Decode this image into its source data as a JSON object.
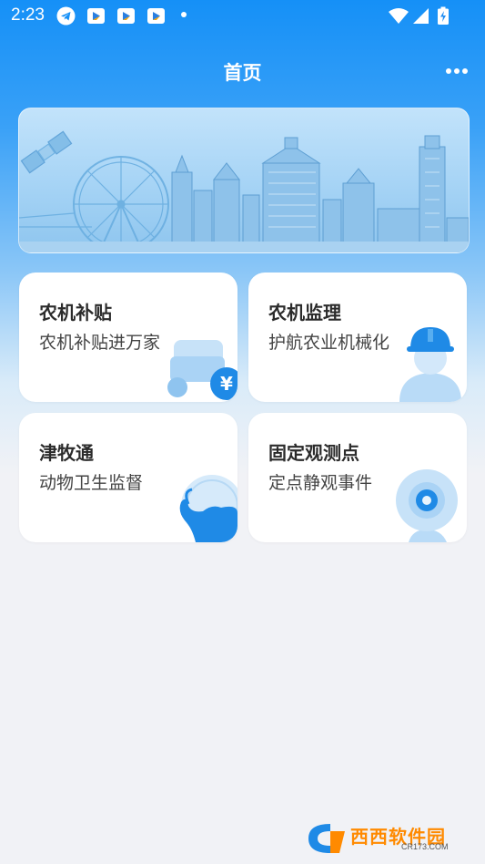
{
  "status_bar": {
    "time": "2:23",
    "notification_icons": [
      "telegram-icon",
      "media-app-icon",
      "media-app-icon",
      "media-app-icon",
      "more-notifications-dot"
    ],
    "system_icons": [
      "wifi-icon",
      "signal-icon",
      "battery-icon"
    ]
  },
  "header": {
    "title": "首页",
    "more_icon": "more-dots-icon"
  },
  "banner": {
    "image": "city-skyline-illustration"
  },
  "cards": [
    {
      "title": "农机补贴",
      "subtitle": "农机补贴进万家",
      "icon": "tractor-subsidy-icon"
    },
    {
      "title": "农机监理",
      "subtitle": "护航农业机械化",
      "icon": "hardhat-worker-icon"
    },
    {
      "title": "津牧通",
      "subtitle": "动物卫生监督",
      "icon": "cattle-icon"
    },
    {
      "title": "固定观测点",
      "subtitle": "定点静观事件",
      "icon": "webcam-icon"
    }
  ],
  "watermark": {
    "text": "西西软件园",
    "site": "CR173.COM"
  },
  "colors": {
    "primary": "#1590f7",
    "icon_blue": "#5fb2f3",
    "icon_dark": "#1e88e5",
    "background": "#f1f2f6"
  }
}
